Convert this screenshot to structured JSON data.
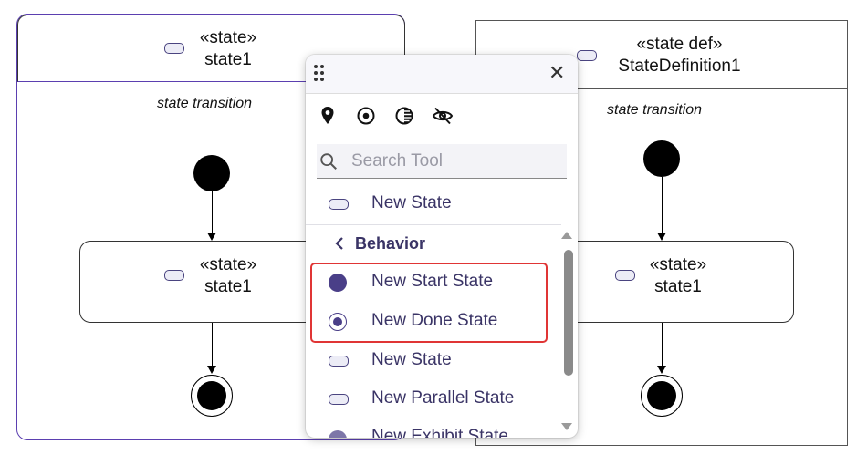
{
  "left_state": {
    "stereotype": "«state»",
    "name": "state1",
    "compartment_title": "state transition",
    "inner_state": {
      "stereotype": "«state»",
      "name": "state1"
    }
  },
  "right_state_def": {
    "stereotype": "«state def»",
    "name": "StateDefinition1",
    "compartment_title": "state transition",
    "inner_state": {
      "stereotype": "«state»",
      "name": "state1"
    }
  },
  "palette": {
    "tool_icons": [
      "pin-icon",
      "target-icon",
      "contrast-icon",
      "eye-slash-icon"
    ],
    "search": {
      "placeholder": "Search Tool",
      "value": ""
    },
    "top_item": {
      "label": "New State",
      "icon": "state-pill-icon"
    },
    "section": {
      "label": "Behavior",
      "icon": "chevron-left-icon"
    },
    "items": [
      {
        "label": "New Start State",
        "icon": "start-state-icon",
        "highlighted": true
      },
      {
        "label": "New Done State",
        "icon": "done-state-icon",
        "highlighted": true
      },
      {
        "label": "New State",
        "icon": "state-pill-icon",
        "highlighted": false
      },
      {
        "label": "New Parallel State",
        "icon": "state-pill-icon",
        "highlighted": false
      },
      {
        "label": "New Exhibit State",
        "icon": "exhibit-state-icon",
        "highlighted": false
      }
    ]
  },
  "colors": {
    "accent": "#5b3fb0",
    "icon_fill": "#4a4480",
    "highlight_border": "#e03535"
  }
}
